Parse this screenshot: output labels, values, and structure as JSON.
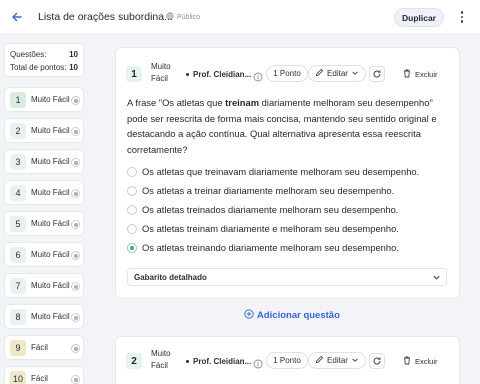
{
  "header": {
    "title": "Lista de orações subordina...",
    "visibility": "Público",
    "duplicate_label": "Duplicar"
  },
  "summary": {
    "questions_label": "Questões:",
    "questions_value": "10",
    "points_label": "Total de pontos:",
    "points_value": "10"
  },
  "question_nav": [
    {
      "num": "1",
      "label": "Muito Fácil"
    },
    {
      "num": "2",
      "label": "Muito Fácil"
    },
    {
      "num": "3",
      "label": "Muito Fácil"
    },
    {
      "num": "4",
      "label": "Muito Fácil"
    },
    {
      "num": "5",
      "label": "Muito Fácil"
    },
    {
      "num": "6",
      "label": "Muito Fácil"
    },
    {
      "num": "7",
      "label": "Muito Fácil"
    },
    {
      "num": "8",
      "label": "Muito Fácil"
    },
    {
      "num": "9",
      "label": "Fácil"
    },
    {
      "num": "10",
      "label": "Fácil"
    }
  ],
  "questions": [
    {
      "num": "1",
      "difficulty": "Muito Fácil",
      "author": "Prof. Cleidian...",
      "points": "1 Ponto",
      "edit_label": "Editar",
      "delete_label": "Excluir",
      "stem_before": "A frase \"Os atletas que ",
      "stem_bold": "treinam",
      "stem_after": " diariamente melhoram seu desempenho\" pode ser reescrita de forma mais concisa, mantendo seu sentido original e destacando a ação contínua. Qual alternativa apresenta essa reescrita corretamente?",
      "options": [
        "Os atletas que treinavam diariamente melhoram seu desempenho.",
        "Os atletas a treinar diariamente melhoram seu desempenho.",
        "Os atletas treinados diariamente melhoram seu desempenho.",
        "Os atletas treinam diariamente e melhoram seu desempenho.",
        "Os atletas treinando diariamente melhoram seu desempenho."
      ],
      "correct_index": 4,
      "gabarito_label": "Gabarito detalhado"
    },
    {
      "num": "2",
      "difficulty": "Muito Fácil",
      "author": "Prof. Cleidian...",
      "points": "1 Ponto",
      "edit_label": "Editar",
      "delete_label": "Excluir"
    }
  ],
  "add_question_label": "Adicionar questão",
  "colors": {
    "accent": "#3a63d9",
    "correct": "#3db26a",
    "number_badge": "#e8f3f0"
  }
}
